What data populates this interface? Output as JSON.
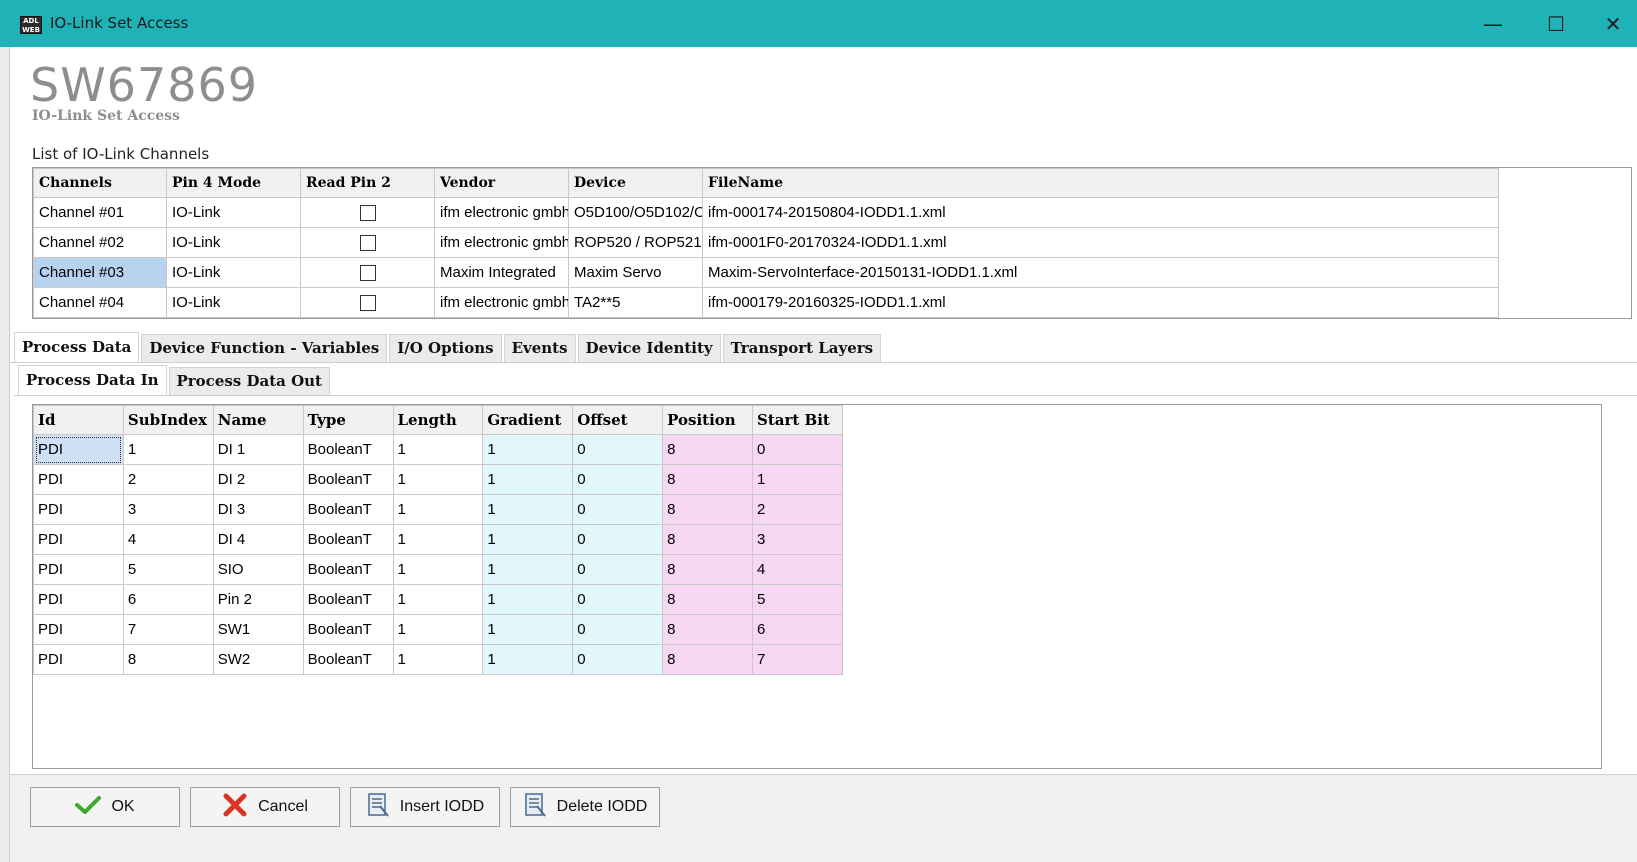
{
  "window": {
    "title": "IO-Link Set Access",
    "icon_text": "ADL WEB"
  },
  "header": {
    "product_code": "SW67869",
    "product_subtitle": "IO-Link Set Access"
  },
  "channels_section": {
    "label": "List of IO-Link Channels",
    "columns": [
      "Channels",
      "Pin 4 Mode",
      "Read Pin 2",
      "Vendor",
      "Device",
      "FileName"
    ],
    "rows": [
      {
        "channel": "Channel #01",
        "pin4": "IO-Link",
        "read_pin2": false,
        "vendor": "ifm electronic gmbh",
        "device": "O5D100/O5D102/O",
        "file": "ifm-000174-20150804-IODD1.1.xml"
      },
      {
        "channel": "Channel #02",
        "pin4": "IO-Link",
        "read_pin2": false,
        "vendor": "ifm electronic gmbh",
        "device": "ROP520 / ROP521",
        "file": "ifm-0001F0-20170324-IODD1.1.xml"
      },
      {
        "channel": "Channel #03",
        "pin4": "IO-Link",
        "read_pin2": false,
        "vendor": "Maxim Integrated",
        "device": "Maxim Servo",
        "file": "Maxim-ServoInterface-20150131-IODD1.1.xml"
      },
      {
        "channel": "Channel #04",
        "pin4": "IO-Link",
        "read_pin2": false,
        "vendor": "ifm electronic gmbh",
        "device": "TA2**5",
        "file": "ifm-000179-20160325-IODD1.1.xml"
      }
    ],
    "selected_channel": "Channel #03"
  },
  "tabs": {
    "main": [
      "Process Data",
      "Device Function - Variables",
      "I/O Options",
      "Events",
      "Device Identity",
      "Transport Layers"
    ],
    "active_main": "Process Data",
    "sub": [
      "Process Data In",
      "Process Data Out"
    ],
    "active_sub": "Process Data In"
  },
  "process_data": {
    "columns": [
      "Id",
      "SubIndex",
      "Name",
      "Type",
      "Length",
      "Gradient",
      "Offset",
      "Position",
      "Start Bit"
    ],
    "rows": [
      [
        "PDI",
        "1",
        "DI 1",
        "BooleanT",
        "1",
        "1",
        "0",
        "8",
        "0"
      ],
      [
        "PDI",
        "2",
        "DI 2",
        "BooleanT",
        "1",
        "1",
        "0",
        "8",
        "1"
      ],
      [
        "PDI",
        "3",
        "DI 3",
        "BooleanT",
        "1",
        "1",
        "0",
        "8",
        "2"
      ],
      [
        "PDI",
        "4",
        "DI 4",
        "BooleanT",
        "1",
        "1",
        "0",
        "8",
        "3"
      ],
      [
        "PDI",
        "5",
        "SIO",
        "BooleanT",
        "1",
        "1",
        "0",
        "8",
        "4"
      ],
      [
        "PDI",
        "6",
        "Pin 2",
        "BooleanT",
        "1",
        "1",
        "0",
        "8",
        "5"
      ],
      [
        "PDI",
        "7",
        "SW1",
        "BooleanT",
        "1",
        "1",
        "0",
        "8",
        "6"
      ],
      [
        "PDI",
        "8",
        "SW2",
        "BooleanT",
        "1",
        "1",
        "0",
        "8",
        "7"
      ]
    ]
  },
  "footer": {
    "ok_label": "OK",
    "cancel_label": "Cancel",
    "insert_label": "Insert IODD",
    "delete_label": "Delete IODD"
  },
  "icons": {
    "ok": "checkmark-icon",
    "cancel": "x-icon",
    "insert": "document-icon",
    "delete": "document-delete-icon"
  },
  "colors": {
    "titlebar": "#1fb3b8",
    "selected_row": "#b8d3f0",
    "cyan_cols": "#e1f7fb",
    "pink_cols": "#f7d7f4"
  }
}
